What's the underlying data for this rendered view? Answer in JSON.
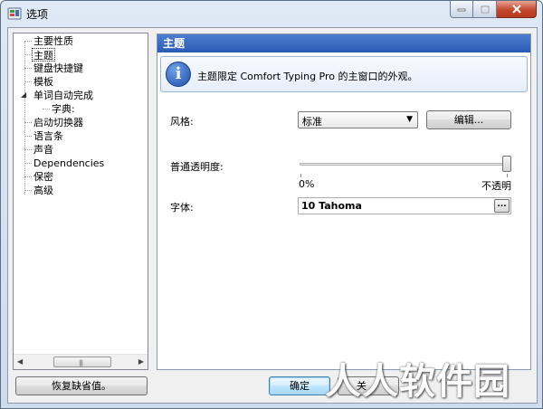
{
  "window": {
    "title": "选项"
  },
  "tree": {
    "items": [
      {
        "label": "主要性质"
      },
      {
        "label": "主题",
        "selected": true
      },
      {
        "label": "键盘快捷键"
      },
      {
        "label": "模板"
      },
      {
        "label": "单词自动完成",
        "expanded": true
      },
      {
        "label": "字典:"
      },
      {
        "label": "启动切换器"
      },
      {
        "label": "语言条"
      },
      {
        "label": "声音"
      },
      {
        "label": "Dependencies"
      },
      {
        "label": "保密"
      },
      {
        "label": "高级"
      }
    ]
  },
  "panel": {
    "header": "主题",
    "info": "主题限定 Comfort Typing Pro 的主窗口的外观。",
    "style_label": "风格:",
    "style_value": "标准",
    "edit_button": "编辑...",
    "opacity_label": "普通透明度:",
    "opacity_min": "0%",
    "opacity_max": "不透明",
    "opacity_value_percent": 100,
    "font_label": "字体:",
    "font_value": "10 Tahoma",
    "font_button": "..."
  },
  "footer": {
    "restore_button": "恢复缺省值。",
    "ok_button": "确定",
    "close_button": "关"
  },
  "watermark": "人人软件园"
}
